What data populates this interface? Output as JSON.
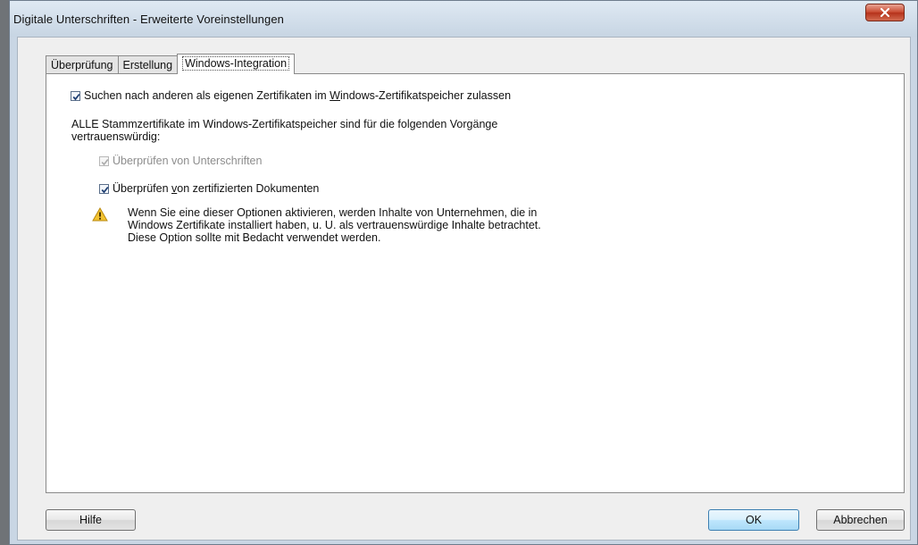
{
  "window": {
    "title": "Digitale Unterschriften - Erweiterte Voreinstellungen",
    "close_label": "×"
  },
  "tabs": [
    {
      "label": "Überprüfung",
      "active": false
    },
    {
      "label": "Erstellung",
      "active": false
    },
    {
      "label": "Windows-Integration",
      "active": true
    }
  ],
  "panel": {
    "search_checkbox": {
      "pre": "Suchen nach anderen als eigenen Zertifikaten im ",
      "accel": "W",
      "post": "indows-Zertifikatspeicher zulassen",
      "checked": true
    },
    "trust_heading_line1": "ALLE Stammzertifikate im Windows-Zertifikatspeicher sind für die folgenden Vorgänge",
    "trust_heading_line2": "vertrauenswürdig:",
    "verify_signatures": {
      "label": "Überprüfen von Unterschriften",
      "checked": true,
      "disabled": true
    },
    "verify_certified": {
      "pre": "Überprüfen ",
      "accel": "v",
      "post": "on zertifizierten Dokumenten",
      "checked": true
    },
    "warning_lines": [
      "Wenn Sie eine dieser Optionen aktivieren, werden Inhalte von Unternehmen, die in",
      "Windows Zertifikate installiert haben, u. U. als vertrauenswürdige Inhalte betrachtet.",
      "Diese Option sollte mit Bedacht verwendet werden."
    ]
  },
  "buttons": {
    "help": "Hilfe",
    "ok": "OK",
    "cancel": "Abbrechen"
  },
  "colors": {
    "warning_icon": "#f2c230",
    "check": "#1f3f73",
    "close_button": "#c94b32"
  },
  "icons": [
    "close-icon",
    "warning-icon",
    "check-icon"
  ]
}
